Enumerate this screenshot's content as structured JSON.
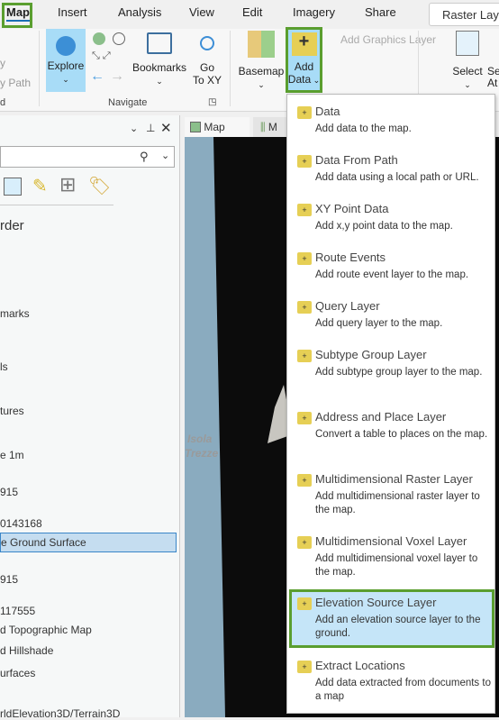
{
  "ribbon_tabs": [
    "Map",
    "Insert",
    "Analysis",
    "View",
    "Edit",
    "Imagery",
    "Share",
    "Raster Layer"
  ],
  "ribbon": {
    "left_cut": [
      "y",
      "y Path",
      "d"
    ],
    "explore": "Explore",
    "bookmarks": "Bookmarks",
    "go_to_xy": [
      "Go",
      "To XY"
    ],
    "navigate_group": "Navigate",
    "basemap": "Basemap",
    "add_data": [
      "Add",
      "Data"
    ],
    "add_graphics_layer": "Add Graphics Layer",
    "select": "Select",
    "select_attr_cut": [
      "Se",
      "At"
    ]
  },
  "contents": {
    "title_cut": "rder",
    "items": [
      "marks",
      "ls",
      "tures",
      "e 1m",
      "915",
      "0143168",
      "e Ground Surface",
      "915",
      "117555",
      "d Topographic Map",
      "d Hillshade",
      "urfaces",
      "rldElevation3D/Terrain3D"
    ],
    "selected_index": 6
  },
  "view_tabs": [
    "Map",
    "M"
  ],
  "map_labels": [
    "Isola",
    "Trezze"
  ],
  "add_data_menu": [
    {
      "title": "Data",
      "desc": "Add data to the map.",
      "icon": "add-data-icon"
    },
    {
      "title": "Data From Path",
      "desc": "Add data using a local path or URL.",
      "icon": "data-from-path-icon"
    },
    {
      "title": "XY Point Data",
      "desc": "Add x,y point data to the map.",
      "icon": "xy-point-icon"
    },
    {
      "title": "Route Events",
      "desc": "Add route event layer to the map.",
      "icon": "route-events-icon"
    },
    {
      "title": "Query Layer",
      "desc": "Add query layer to the map.",
      "icon": "query-layer-icon"
    },
    {
      "title": "Subtype Group Layer",
      "desc": "Add subtype group layer to the map.",
      "icon": "subtype-group-icon"
    },
    {
      "title": "Address and Place Layer",
      "desc": "Convert a table to places on the map.",
      "icon": "address-place-icon"
    },
    {
      "title": "Multidimensional Raster Layer",
      "desc": "Add multidimensional raster layer to the map.",
      "icon": "md-raster-icon"
    },
    {
      "title": "Multidimensional Voxel Layer",
      "desc": "Add multidimensional voxel layer to the map.",
      "icon": "voxel-icon"
    },
    {
      "title": "Elevation Source Layer",
      "desc": "Add an elevation source layer to the ground.",
      "icon": "elevation-source-icon"
    },
    {
      "title": "Extract Locations",
      "desc": "Add data extracted from documents to a map",
      "icon": "extract-locations-icon"
    }
  ],
  "colors": {
    "highlight": "#5a9e2f",
    "selected_bg": "#c5ddf0",
    "menu_hover": "#c5e5f8"
  }
}
